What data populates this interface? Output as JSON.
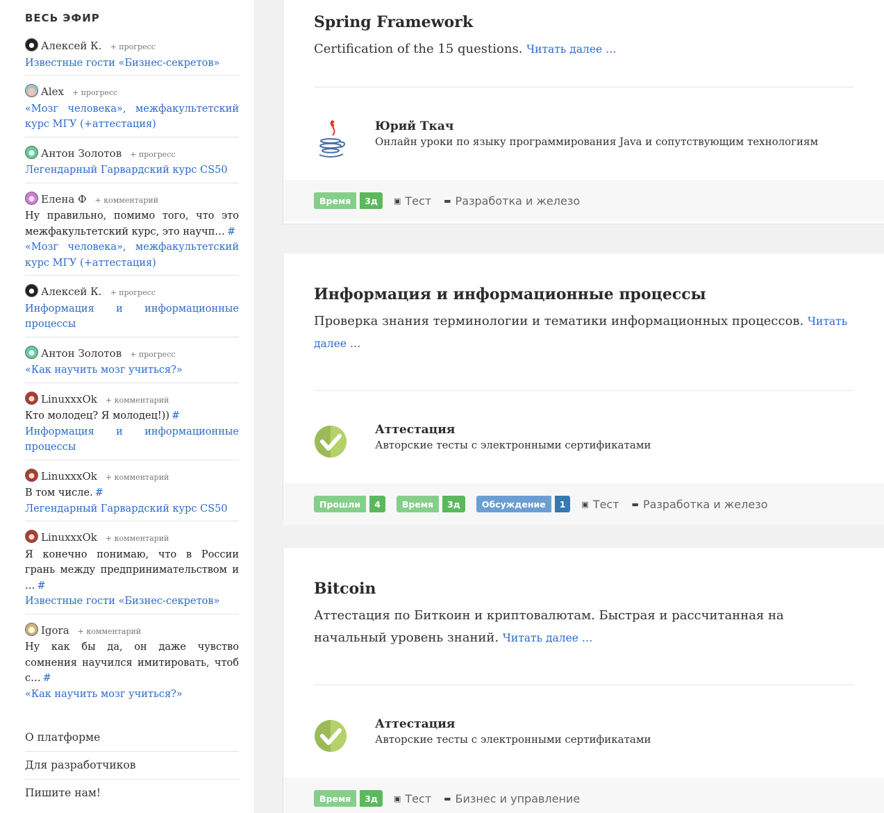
{
  "sidebar": {
    "title": "ВЕСЬ ЭФИР",
    "feed": [
      {
        "user": "Алексей К.",
        "action": "+ прогресс",
        "text": "",
        "link": "Известные гости «Бизнес-секретов»"
      },
      {
        "user": "Alex",
        "action": "+ прогресс",
        "text": "",
        "link": "«Мозг человека», межфакультетский курс МГУ (+аттестация)"
      },
      {
        "user": "Антон Золотов",
        "action": "+ прогресс",
        "text": "",
        "link": "Легендарный Гарвардский курс CS50"
      },
      {
        "user": "Елена Ф",
        "action": "+ комментарий",
        "text": "Ну правильно, помимо того, что это межфакультетский курс, это научп…",
        "hash": "#",
        "link": "«Мозг человека», межфакультетский курс МГУ (+аттестация)"
      },
      {
        "user": "Алексей К.",
        "action": "+ прогресс",
        "text": "",
        "link": "Информация и информационные процессы"
      },
      {
        "user": "Антон Золотов",
        "action": "+ прогресс",
        "text": "",
        "link": "«Как научить мозг учиться?»"
      },
      {
        "user": "LinuxxxOk",
        "action": "+ комментарий",
        "text": "Кто молодец? Я молодец!))",
        "hash": "#",
        "link": "Информация и информационные процессы"
      },
      {
        "user": "LinuxxxOk",
        "action": "+ комментарий",
        "text": "В том числе.",
        "hash": "#",
        "link": "Легендарный Гарвардский курс CS50"
      },
      {
        "user": "LinuxxxOk",
        "action": "+ комментарий",
        "text": "Я конечно понимаю, что в России грань между предпринимательством и …",
        "hash": "#",
        "link": "Известные гости «Бизнес-секретов»"
      },
      {
        "user": "Igora",
        "action": "+ комментарий",
        "text": "Ну как бы да, он даже чувство сомнения научился имитировать, чтоб с…",
        "hash": "#",
        "link": "«Как научить мозг учиться?»"
      }
    ],
    "links": [
      "О платформе",
      "Для разработчиков",
      "Пишите нам!"
    ]
  },
  "cards": [
    {
      "title": "Spring Framework",
      "desc": "Certification of the 15 questions.",
      "read_more": "Читать далее …",
      "author_name": "Юрий Ткач",
      "author_sub": "Онлайн уроки по языку программирования Java и сопутствующим технологиям",
      "badges": [
        {
          "label": "Время",
          "count": "3д"
        }
      ],
      "type": "Тест",
      "category": "Разработка и железо"
    },
    {
      "title": "Информация и информационные процессы",
      "desc": "Проверка знания терминологии и тематики информационных процессов.",
      "read_more": "Читать далее …",
      "author_name": "Аттестация",
      "author_sub": "Авторские тесты с электронными сертификатами",
      "badges": [
        {
          "label": "Прошли",
          "count": "4"
        },
        {
          "label": "Время",
          "count": "3д"
        },
        {
          "label": "Обсуждение",
          "count": "1"
        }
      ],
      "type": "Тест",
      "category": "Разработка и железо"
    },
    {
      "title": "Bitcoin",
      "desc": "Аттестация по Биткоин и криптовалютам. Быстрая и рассчитанная на начальный уровень знаний.",
      "read_more": "Читать далее …",
      "author_name": "Аттестация",
      "author_sub": "Авторские тесты с электронными сертификатами",
      "badges": [
        {
          "label": "Время",
          "count": "3д"
        }
      ],
      "type": "Тест",
      "category": "Бизнес и управление"
    }
  ],
  "colors": {
    "link": "#2b6ac9",
    "badge_green": "#5cb85c",
    "badge_blue": "#337ab7"
  }
}
